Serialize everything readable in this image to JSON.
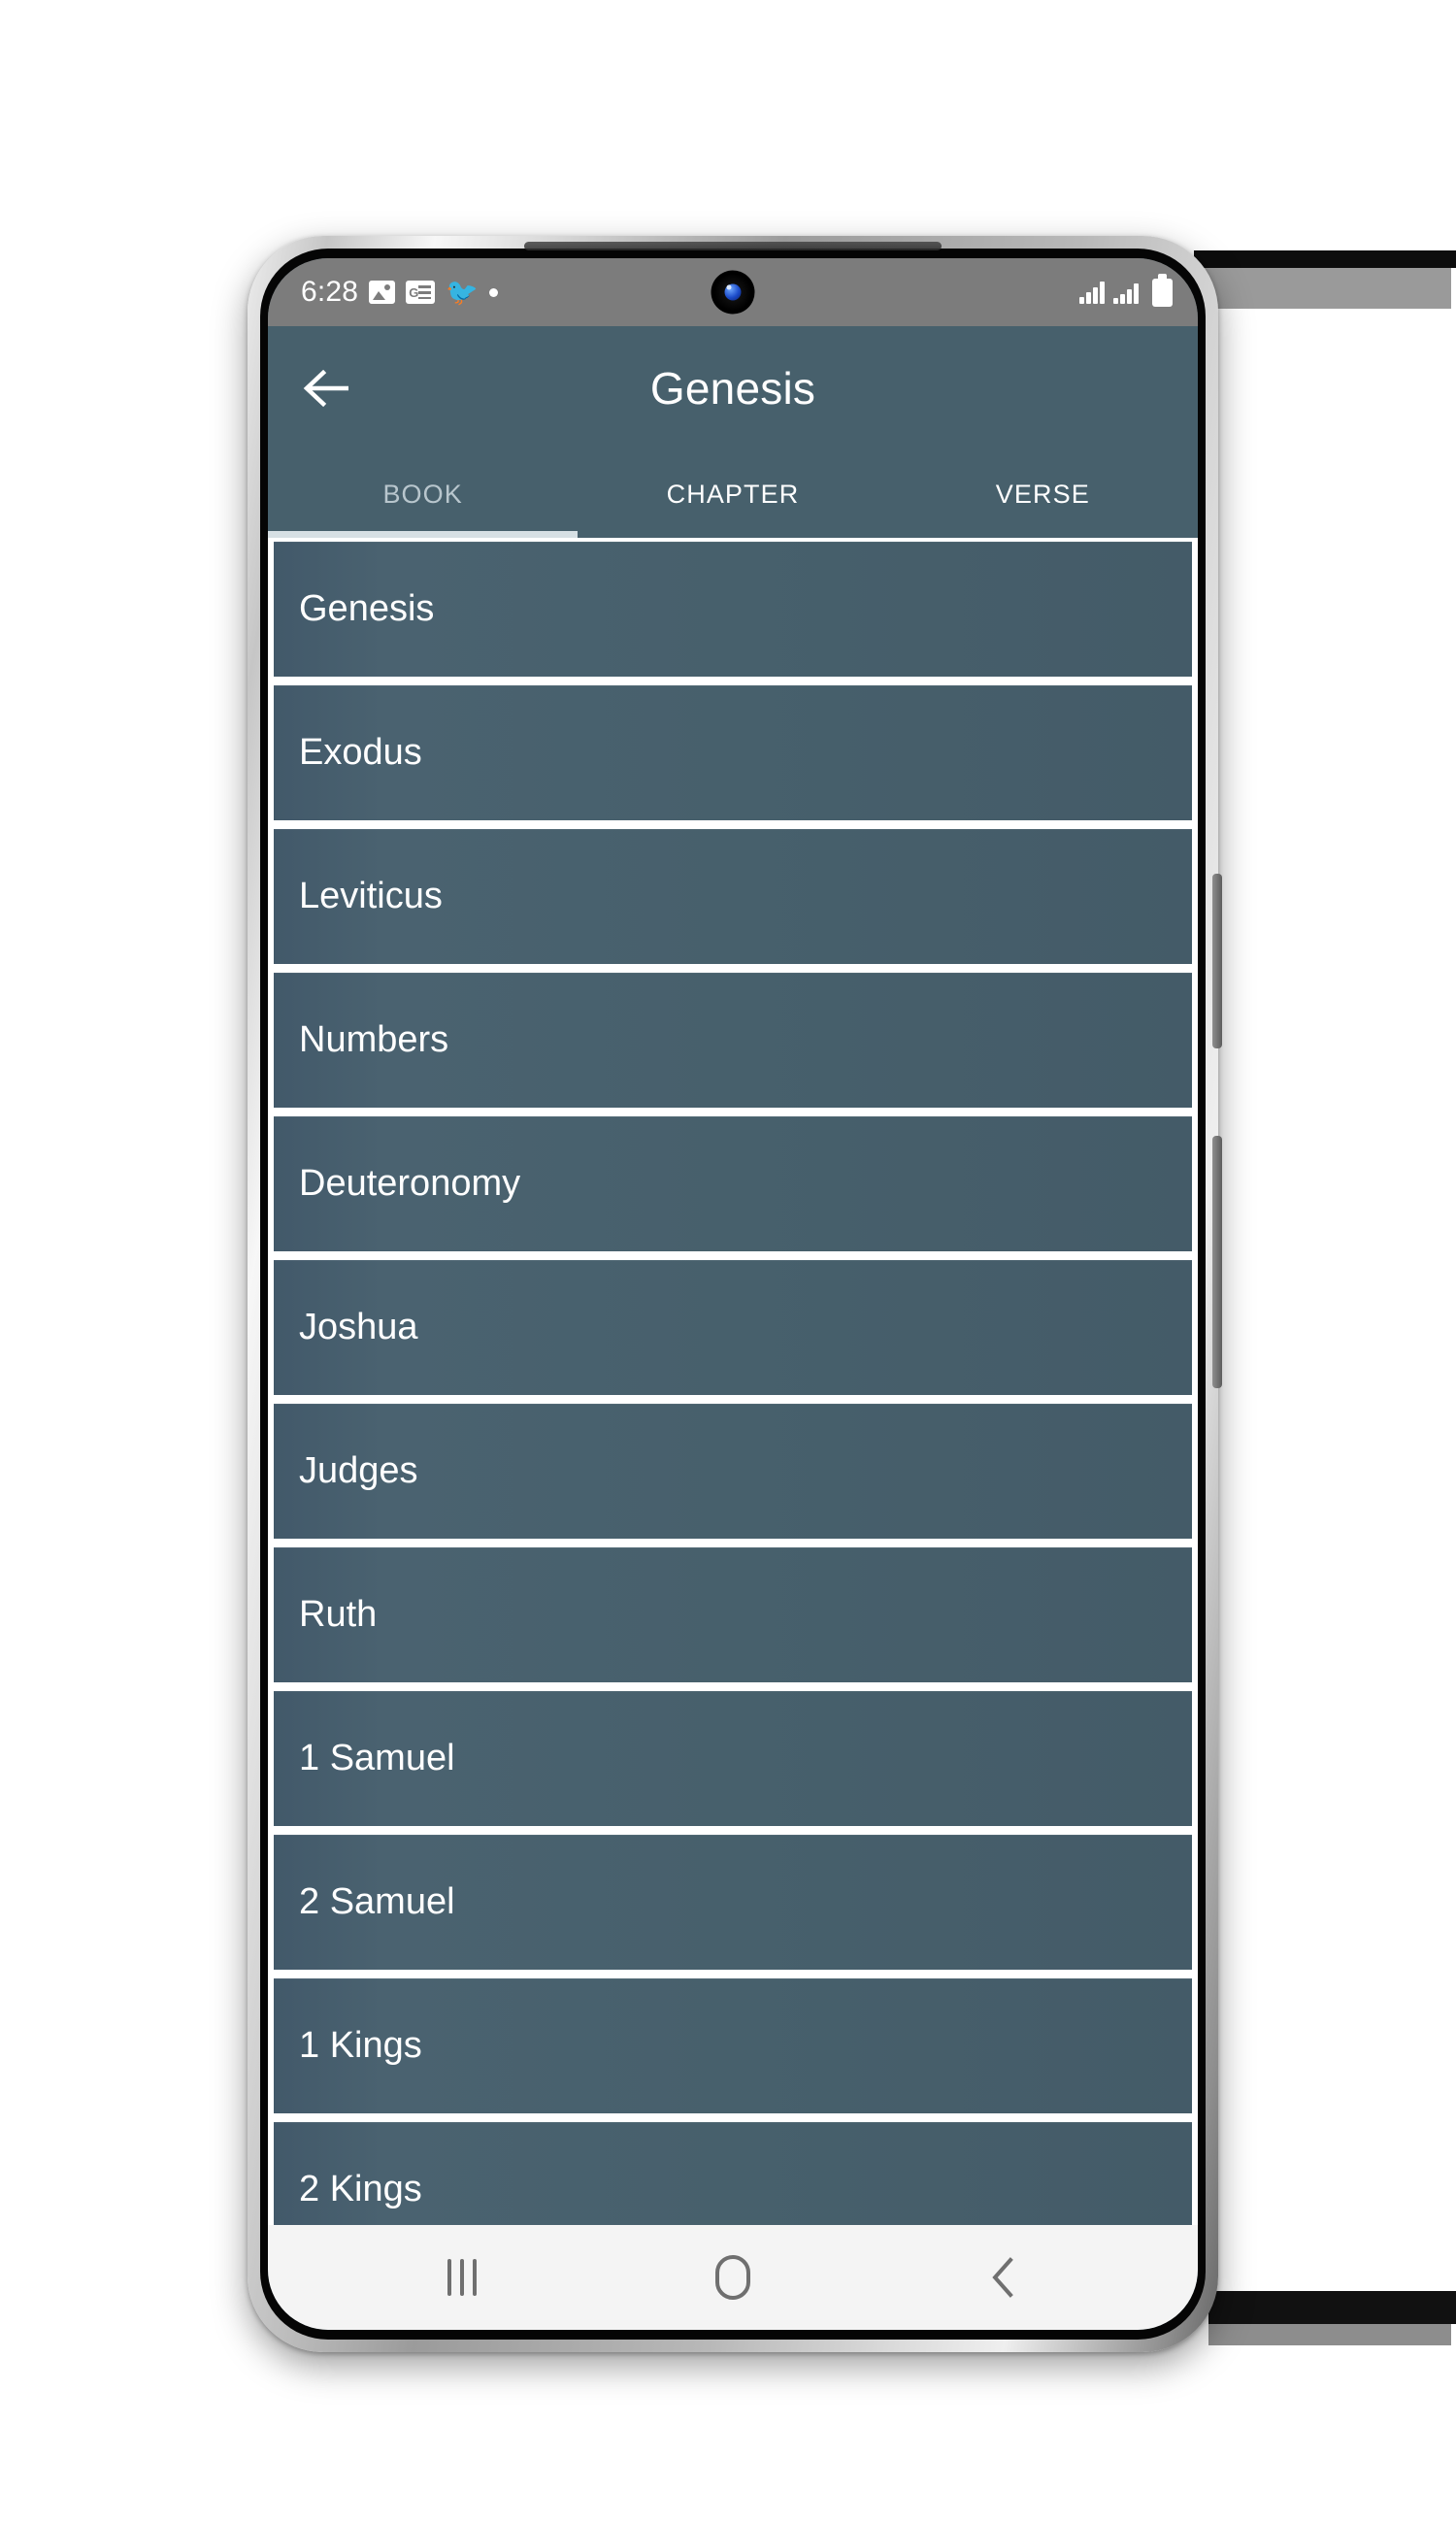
{
  "device": {
    "type": "android-phone",
    "frame_color": "#bdbdbd",
    "screen_bg": "#47606c"
  },
  "status_bar": {
    "time": "6:28",
    "background": "#7c7c7c",
    "left_icons": [
      {
        "name": "photos-icon",
        "glyph": "image"
      },
      {
        "name": "google-news-icon",
        "glyph": "G-news"
      },
      {
        "name": "twitter-icon",
        "glyph": "ᵇ"
      },
      {
        "name": "notification-dot-icon",
        "glyph": "dot"
      }
    ],
    "right_icons": [
      {
        "name": "signal-sim1-icon",
        "label": "signal bars sim 1"
      },
      {
        "name": "signal-sim2-icon",
        "label": "signal bars sim 2"
      },
      {
        "name": "battery-icon",
        "label": "battery full"
      }
    ],
    "camera": "front-camera-punch-hole"
  },
  "app_bar": {
    "back_label": "Back",
    "title": "Genesis",
    "background": "#47606c",
    "text_color": "#ffffff"
  },
  "tabs": {
    "selected_index": 0,
    "indicator_color": "#d7e0e4",
    "items": [
      {
        "label": "BOOK"
      },
      {
        "label": "CHAPTER"
      },
      {
        "label": "VERSE"
      }
    ]
  },
  "book_list": {
    "item_bg": "#47606c",
    "item_text_color": "#ffffff",
    "items": [
      {
        "label": "Genesis"
      },
      {
        "label": "Exodus"
      },
      {
        "label": "Leviticus"
      },
      {
        "label": "Numbers"
      },
      {
        "label": "Deuteronomy"
      },
      {
        "label": "Joshua"
      },
      {
        "label": "Judges"
      },
      {
        "label": "Ruth"
      },
      {
        "label": "1 Samuel"
      },
      {
        "label": "2 Samuel"
      },
      {
        "label": "1 Kings"
      },
      {
        "label": "2 Kings"
      }
    ]
  },
  "nav_bar": {
    "background": "#f4f4f4",
    "buttons": [
      {
        "name": "recents-button",
        "label": "Recents"
      },
      {
        "name": "home-button",
        "label": "Home"
      },
      {
        "name": "back-button",
        "label": "Back"
      }
    ]
  }
}
